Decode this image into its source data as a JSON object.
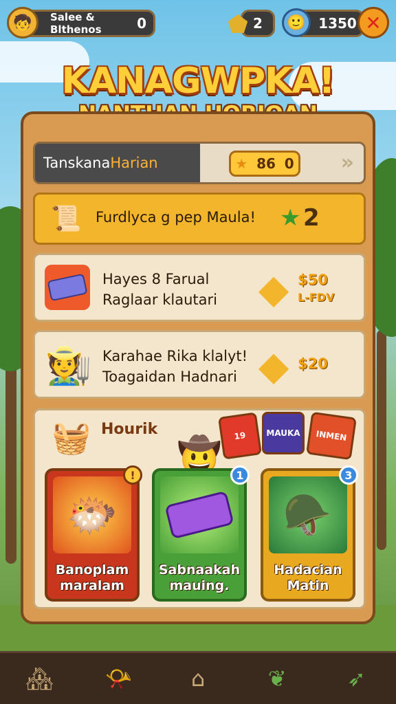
{
  "topbar": {
    "player_name": "Salee & Blthenos",
    "player_level": "0",
    "gems": "2",
    "coins": "1350",
    "close_symbol": "✕"
  },
  "title": "KANAGWPKA!",
  "subtitle": "NANTHAN HORIQAN",
  "tab": {
    "label_main": "Tanskana ",
    "label_accent": "Harian",
    "stars": "86",
    "count": "0"
  },
  "daily": {
    "text": "Furdlyca g pep Maula!",
    "stars": "2"
  },
  "quests": [
    {
      "line1": "Hayes 8 Farual",
      "line2": "Raglaar klautari",
      "reward": "$50",
      "reward_sub": "L-FDV"
    },
    {
      "line1": "Karahae Rika klalyt!",
      "line2": "Toagaidan Hadnari",
      "reward": "$20",
      "reward_sub": ""
    }
  ],
  "shop": {
    "header": "Hourik",
    "mini_cards": [
      "19",
      "MAUKA",
      "INMEN"
    ],
    "cards": [
      {
        "line1": "Banoplam",
        "line2": "maralam",
        "badge": "!"
      },
      {
        "line1": "Sabnaakah",
        "line2": "mauing.",
        "badge": "1"
      },
      {
        "line1": "Hadacian",
        "line2": "Matin",
        "badge": "3"
      }
    ]
  },
  "colors": {
    "accent": "#ffcf3a",
    "panel": "#d99a52",
    "gold": "#f2b52b"
  }
}
